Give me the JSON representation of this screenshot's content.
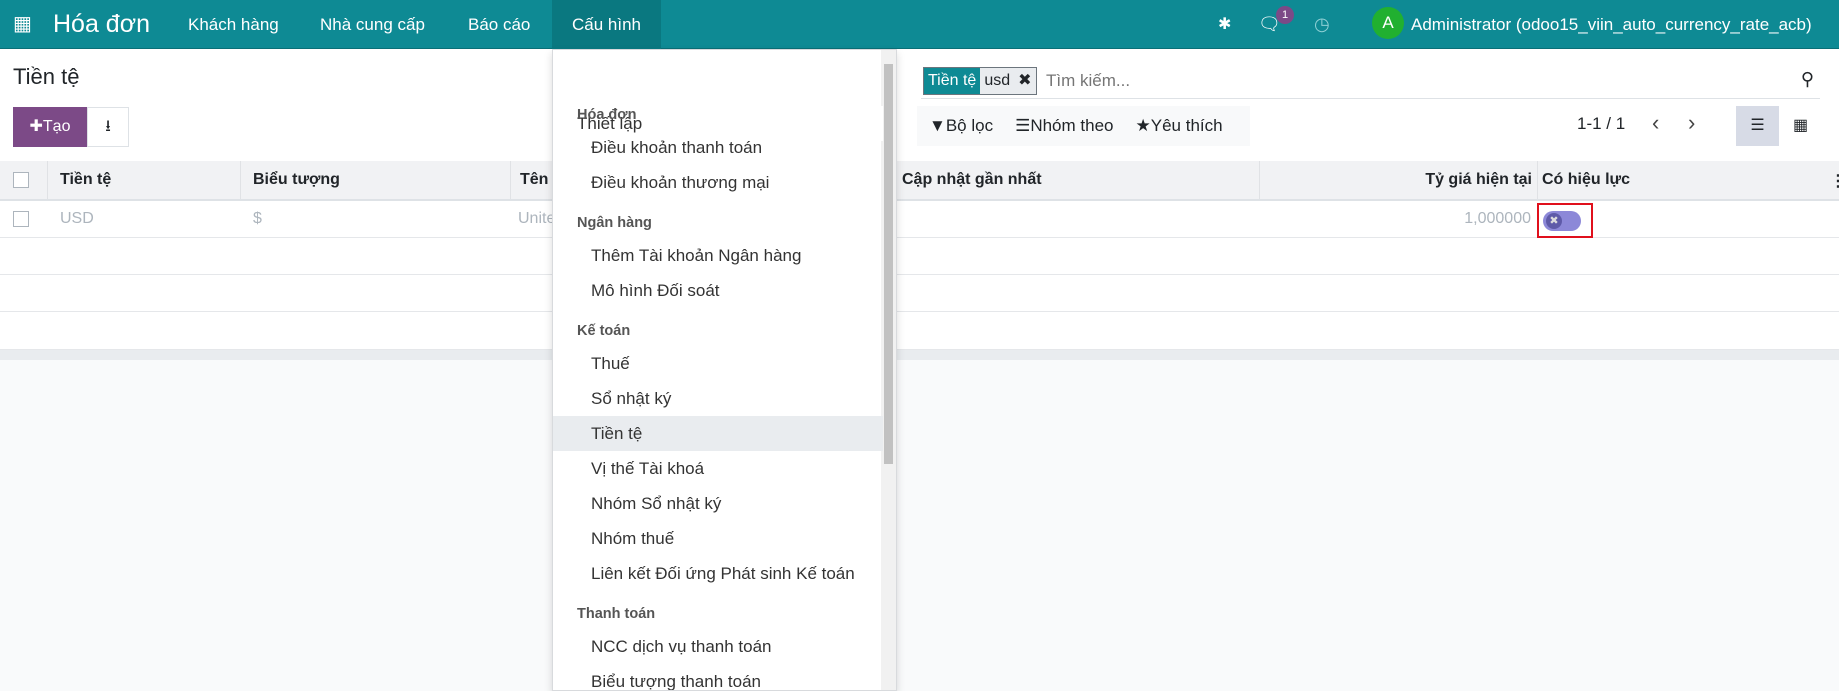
{
  "navbar": {
    "app_name": "Hóa đơn",
    "menus": [
      "Khách hàng",
      "Nhà cung cấp",
      "Báo cáo",
      "Cấu hình"
    ],
    "chat_count": "1",
    "avatar_letter": "A",
    "user": "Administrator (odoo15_viin_auto_currency_rate_acb)"
  },
  "page": {
    "title": "Tiền tệ",
    "create_label": "Tạo"
  },
  "search": {
    "facet_key": "Tiền tệ",
    "facet_value": "usd",
    "placeholder": "Tìm kiếm...",
    "filter": "Bộ lọc",
    "group_by": "Nhóm theo",
    "favorites": "Yêu thích",
    "pager": "1-1 / 1"
  },
  "table": {
    "columns": [
      "Tiền tệ",
      "Biểu tượng",
      "Tên",
      "Cập nhật gần nhất",
      "Tỷ giá hiện tại",
      "Có hiệu lực"
    ],
    "rows": [
      {
        "currency": "USD",
        "symbol": "$",
        "name": "Unite",
        "rate": "1,000000",
        "active": false
      }
    ]
  },
  "menu": {
    "settings": "Thiết lập",
    "sections": [
      {
        "header": "Hóa đơn",
        "items": [
          "Điều khoản thanh toán",
          "Điều khoản thương mại"
        ]
      },
      {
        "header": "Ngân hàng",
        "items": [
          "Thêm Tài khoản Ngân hàng",
          "Mô hình Đối soát"
        ]
      },
      {
        "header": "Kế toán",
        "items": [
          "Thuế",
          "Sổ nhật ký",
          "Tiền tệ",
          "Vị thế Tài khoá",
          "Nhóm Sổ nhật ký",
          "Nhóm thuế",
          "Liên kết Đối ứng Phát sinh Kế toán"
        ]
      },
      {
        "header": "Thanh toán",
        "items": [
          "NCC dịch vụ thanh toán",
          "Biểu tượng thanh toán"
        ]
      }
    ],
    "selected": "Tiền tệ"
  },
  "colors": {
    "navbar": "#0e8a94",
    "primary": "#7c4a87",
    "highlight": "#e0101c"
  }
}
